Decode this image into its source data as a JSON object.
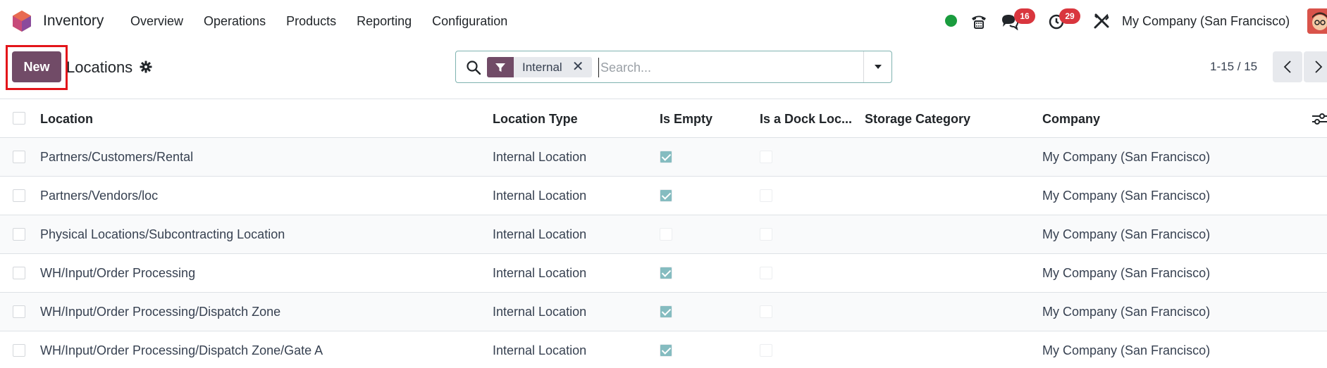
{
  "navbar": {
    "app_name": "Inventory",
    "menu": [
      "Overview",
      "Operations",
      "Products",
      "Reporting",
      "Configuration"
    ],
    "messages_badge": "16",
    "activities_badge": "29",
    "company": "My Company (San Francisco)",
    "status_color": "#1a9c3e"
  },
  "control_panel": {
    "new_label": "New",
    "title": "Locations",
    "search": {
      "facet_label": "Internal",
      "placeholder": "Search..."
    },
    "pager": "1-15 / 15"
  },
  "table": {
    "headers": [
      "Location",
      "Location Type",
      "Is Empty",
      "Is a Dock Loc...",
      "Storage Category",
      "Company"
    ],
    "rows": [
      {
        "location": "Partners/Customers/Rental",
        "type": "Internal Location",
        "is_empty": true,
        "is_dock": false,
        "storage_category": "",
        "company": "My Company (San Francisco)"
      },
      {
        "location": "Partners/Vendors/loc",
        "type": "Internal Location",
        "is_empty": true,
        "is_dock": false,
        "storage_category": "",
        "company": "My Company (San Francisco)"
      },
      {
        "location": "Physical Locations/Subcontracting Location",
        "type": "Internal Location",
        "is_empty": false,
        "is_dock": false,
        "storage_category": "",
        "company": "My Company (San Francisco)"
      },
      {
        "location": "WH/Input/Order Processing",
        "type": "Internal Location",
        "is_empty": true,
        "is_dock": false,
        "storage_category": "",
        "company": "My Company (San Francisco)"
      },
      {
        "location": "WH/Input/Order Processing/Dispatch Zone",
        "type": "Internal Location",
        "is_empty": true,
        "is_dock": false,
        "storage_category": "",
        "company": "My Company (San Francisco)"
      },
      {
        "location": "WH/Input/Order Processing/Dispatch Zone/Gate A",
        "type": "Internal Location",
        "is_empty": true,
        "is_dock": false,
        "storage_category": "",
        "company": "My Company (San Francisco)"
      }
    ]
  },
  "colors": {
    "primary": "#714b67",
    "checkbox_checked": "#85bcc0",
    "badge": "#d9363e",
    "highlight": "#e3151a"
  }
}
